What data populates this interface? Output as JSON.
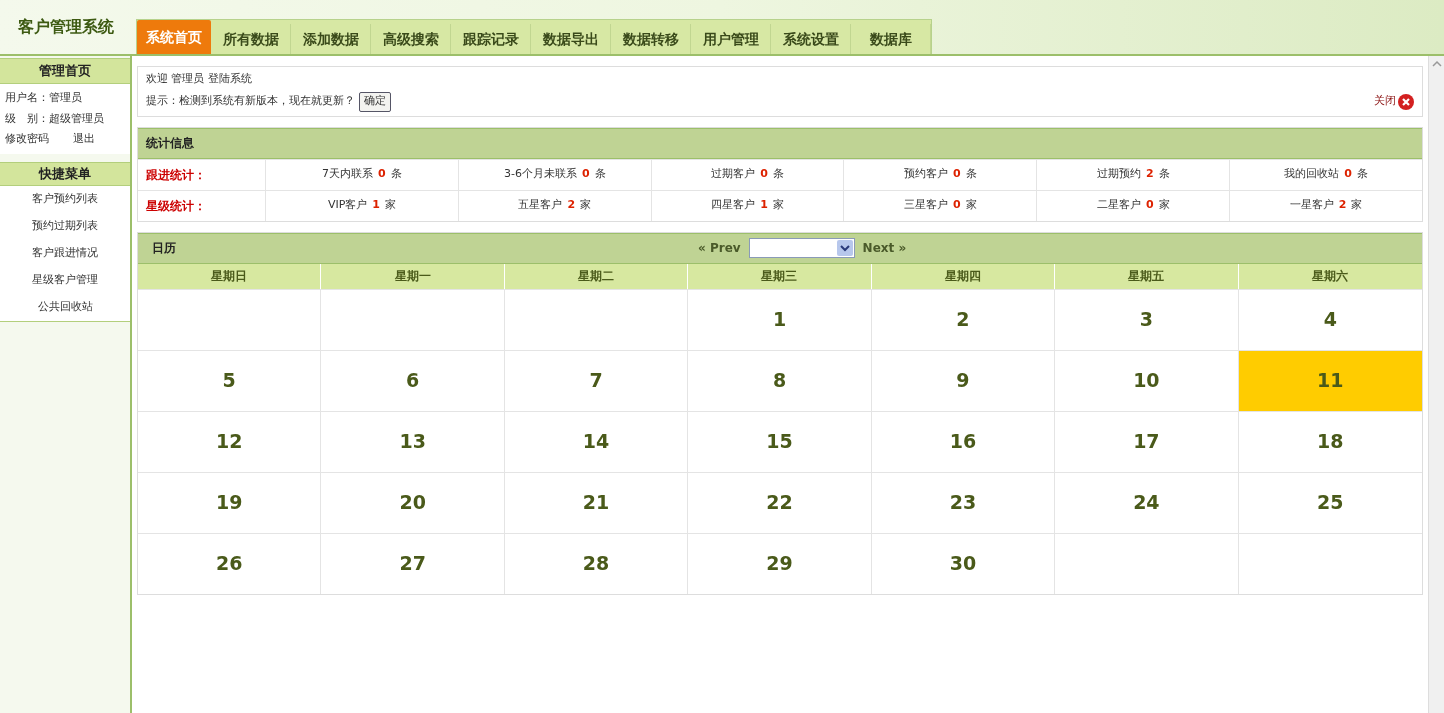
{
  "header": {
    "logo": "客户管理系统"
  },
  "tabs": [
    {
      "label": "系统首页",
      "selected": true
    },
    {
      "label": "所有数据",
      "selected": false
    },
    {
      "label": "添加数据",
      "selected": false
    },
    {
      "label": "高级搜索",
      "selected": false
    },
    {
      "label": "跟踪记录",
      "selected": false
    },
    {
      "label": "数据导出",
      "selected": false
    },
    {
      "label": "数据转移",
      "selected": false
    },
    {
      "label": "用户管理",
      "selected": false
    },
    {
      "label": "系统设置",
      "selected": false
    },
    {
      "label": "数据库",
      "selected": false
    }
  ],
  "sidebar": {
    "title": "管理首页",
    "user_lines": [
      "用户名：管理员",
      "级　别：超级管理员"
    ],
    "links": [
      "修改密码",
      "退出"
    ],
    "menu_title": "快捷菜单",
    "menu": [
      "客户预约列表",
      "预约过期列表",
      "客户跟进情况",
      "星级客户管理",
      "公共回收站"
    ]
  },
  "notice": {
    "welcome": "欢迎 管理员 登陆系统",
    "message": "提示：检测到系统有新版本，现在就更新？",
    "confirm": "确定",
    "close": "关闭"
  },
  "stats": {
    "title": "统计信息",
    "rows": [
      {
        "label": "跟进统计：",
        "items": [
          {
            "label": "7天内联系",
            "count": "0",
            "unit": "条"
          },
          {
            "label": "3-6个月未联系",
            "count": "0",
            "unit": "条"
          },
          {
            "label": "过期客户",
            "count": "0",
            "unit": "条"
          },
          {
            "label": "预约客户",
            "count": "0",
            "unit": "条"
          },
          {
            "label": "过期预约",
            "count": "2",
            "unit": "条"
          },
          {
            "label": "我的回收站",
            "count": "0",
            "unit": "条"
          }
        ]
      },
      {
        "label": "星级统计：",
        "items": [
          {
            "label": "VIP客户",
            "count": "1",
            "unit": "家"
          },
          {
            "label": "五星客户",
            "count": "2",
            "unit": "家"
          },
          {
            "label": "四星客户",
            "count": "1",
            "unit": "家"
          },
          {
            "label": "三星客户",
            "count": "0",
            "unit": "家"
          },
          {
            "label": "二星客户",
            "count": "0",
            "unit": "家"
          },
          {
            "label": "一星客户",
            "count": "2",
            "unit": "家"
          }
        ]
      }
    ]
  },
  "calendar": {
    "title": "日历",
    "prev": "« Prev",
    "next": "Next »",
    "weekdays": [
      "星期日",
      "星期一",
      "星期二",
      "星期三",
      "星期四",
      "星期五",
      "星期六"
    ],
    "weeks": [
      [
        {
          "kind": "blank"
        },
        {
          "kind": "blank"
        },
        {
          "kind": "blank"
        },
        {
          "kind": "day",
          "day": "1",
          "selected": false
        },
        {
          "kind": "day",
          "day": "2",
          "selected": false
        },
        {
          "kind": "day",
          "day": "3",
          "selected": false
        },
        {
          "kind": "day",
          "day": "4",
          "selected": false
        }
      ],
      [
        {
          "kind": "day",
          "day": "5",
          "selected": false
        },
        {
          "kind": "day",
          "day": "6",
          "selected": false
        },
        {
          "kind": "day",
          "day": "7",
          "selected": false
        },
        {
          "kind": "day",
          "day": "8",
          "selected": false
        },
        {
          "kind": "day",
          "day": "9",
          "selected": false
        },
        {
          "kind": "day",
          "day": "10",
          "selected": false
        },
        {
          "kind": "day",
          "day": "11",
          "selected": true
        }
      ],
      [
        {
          "kind": "day",
          "day": "12",
          "selected": false
        },
        {
          "kind": "day",
          "day": "13",
          "selected": false
        },
        {
          "kind": "day",
          "day": "14",
          "selected": false
        },
        {
          "kind": "day",
          "day": "15",
          "selected": false
        },
        {
          "kind": "day",
          "day": "16",
          "selected": false
        },
        {
          "kind": "day",
          "day": "17",
          "selected": false
        },
        {
          "kind": "day",
          "day": "18",
          "selected": false
        }
      ],
      [
        {
          "kind": "day",
          "day": "19",
          "selected": false
        },
        {
          "kind": "day",
          "day": "20",
          "selected": false
        },
        {
          "kind": "day",
          "day": "21",
          "selected": false
        },
        {
          "kind": "day",
          "day": "22",
          "selected": false
        },
        {
          "kind": "day",
          "day": "23",
          "selected": false
        },
        {
          "kind": "day",
          "day": "24",
          "selected": false
        },
        {
          "kind": "day",
          "day": "25",
          "selected": false
        }
      ],
      [
        {
          "kind": "day",
          "day": "26",
          "selected": false
        },
        {
          "kind": "day",
          "day": "27",
          "selected": false
        },
        {
          "kind": "day",
          "day": "28",
          "selected": false
        },
        {
          "kind": "day",
          "day": "29",
          "selected": false
        },
        {
          "kind": "day",
          "day": "30",
          "selected": false
        },
        {
          "kind": "blank"
        },
        {
          "kind": "blank"
        }
      ]
    ]
  }
}
